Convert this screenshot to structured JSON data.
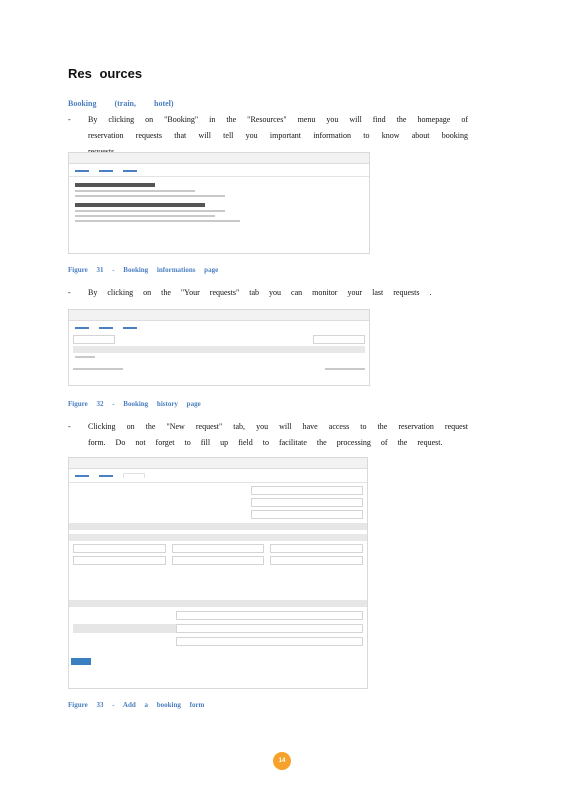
{
  "heading": "Res ources",
  "subheading": "Booking (train, hotel)",
  "bullets": [
    "By clicking on \"Booking\" in the \"Resources\" menu you will find the homepage of reservation requests that will tell you important information to know about booking requests .",
    "By clicking on the \"Your requests\" tab you can monitor your last requests .",
    "Clicking on the \"New request\" tab, you will have access to the reservation request form. Do not forget to fill up field to facilitate the processing of the request."
  ],
  "captions": [
    "Figure 31 - Booking informations page",
    "Figure 32 - Booking history page",
    "Figure 33 - Add a booking form"
  ],
  "page_number": "14"
}
